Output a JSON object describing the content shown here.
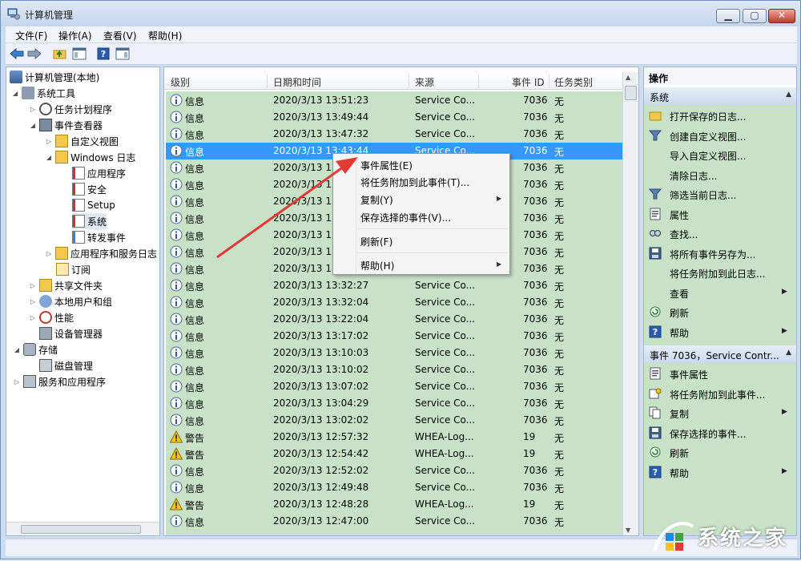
{
  "window": {
    "title": "计算机管理"
  },
  "menu": [
    "文件(F)",
    "操作(A)",
    "查看(V)",
    "帮助(H)"
  ],
  "tree": [
    {
      "label": "计算机管理(本地)"
    },
    {
      "label": "系统工具"
    },
    {
      "label": "任务计划程序"
    },
    {
      "label": "事件查看器"
    },
    {
      "label": "自定义视图"
    },
    {
      "label": "Windows 日志"
    },
    {
      "label": "应用程序"
    },
    {
      "label": "安全"
    },
    {
      "label": "Setup"
    },
    {
      "label": "系统"
    },
    {
      "label": "转发事件"
    },
    {
      "label": "应用程序和服务日志"
    },
    {
      "label": "订阅"
    },
    {
      "label": "共享文件夹"
    },
    {
      "label": "本地用户和组"
    },
    {
      "label": "性能"
    },
    {
      "label": "设备管理器"
    },
    {
      "label": "存储"
    },
    {
      "label": "磁盘管理"
    },
    {
      "label": "服务和应用程序"
    }
  ],
  "columns": {
    "level": "级别",
    "datetime": "日期和时间",
    "source": "来源",
    "event_id": "事件 ID",
    "task": "任务类别"
  },
  "rows": [
    {
      "level": "信息",
      "type": "info",
      "datetime": "2020/3/13 13:51:23",
      "source": "Service Co...",
      "id": "7036",
      "task": "无"
    },
    {
      "level": "信息",
      "type": "info",
      "datetime": "2020/3/13 13:49:44",
      "source": "Service Co...",
      "id": "7036",
      "task": "无"
    },
    {
      "level": "信息",
      "type": "info",
      "datetime": "2020/3/13 13:47:32",
      "source": "Service Co...",
      "id": "7036",
      "task": "无"
    },
    {
      "level": "信息",
      "type": "info",
      "datetime": "2020/3/13 13:43:44",
      "source": "Service Co...",
      "id": "7036",
      "task": "无",
      "selected": true
    },
    {
      "level": "信息",
      "type": "info",
      "datetime": "2020/3/13 13",
      "source": "",
      "id": "7036",
      "task": "无"
    },
    {
      "level": "信息",
      "type": "info",
      "datetime": "2020/3/13 13",
      "source": "",
      "id": "7036",
      "task": "无"
    },
    {
      "level": "信息",
      "type": "info",
      "datetime": "2020/3/13 13",
      "source": "",
      "id": "7036",
      "task": "无"
    },
    {
      "level": "信息",
      "type": "info",
      "datetime": "2020/3/13 13",
      "source": "",
      "id": "7036",
      "task": "无"
    },
    {
      "level": "信息",
      "type": "info",
      "datetime": "2020/3/13 13",
      "source": "",
      "id": "7036",
      "task": "无"
    },
    {
      "level": "信息",
      "type": "info",
      "datetime": "2020/3/13 13",
      "source": "",
      "id": "7036",
      "task": "无"
    },
    {
      "level": "信息",
      "type": "info",
      "datetime": "2020/3/13 13",
      "source": "",
      "id": "7036",
      "task": "无"
    },
    {
      "level": "信息",
      "type": "info",
      "datetime": "2020/3/13 13:32:27",
      "source": "Service Co...",
      "id": "7036",
      "task": "无"
    },
    {
      "level": "信息",
      "type": "info",
      "datetime": "2020/3/13 13:32:04",
      "source": "Service Co...",
      "id": "7036",
      "task": "无"
    },
    {
      "level": "信息",
      "type": "info",
      "datetime": "2020/3/13 13:22:04",
      "source": "Service Co...",
      "id": "7036",
      "task": "无"
    },
    {
      "level": "信息",
      "type": "info",
      "datetime": "2020/3/13 13:17:02",
      "source": "Service Co...",
      "id": "7036",
      "task": "无"
    },
    {
      "level": "信息",
      "type": "info",
      "datetime": "2020/3/13 13:10:03",
      "source": "Service Co...",
      "id": "7036",
      "task": "无"
    },
    {
      "level": "信息",
      "type": "info",
      "datetime": "2020/3/13 13:10:02",
      "source": "Service Co...",
      "id": "7036",
      "task": "无"
    },
    {
      "level": "信息",
      "type": "info",
      "datetime": "2020/3/13 13:07:02",
      "source": "Service Co...",
      "id": "7036",
      "task": "无"
    },
    {
      "level": "信息",
      "type": "info",
      "datetime": "2020/3/13 13:04:29",
      "source": "Service Co...",
      "id": "7036",
      "task": "无"
    },
    {
      "level": "信息",
      "type": "info",
      "datetime": "2020/3/13 13:02:02",
      "source": "Service Co...",
      "id": "7036",
      "task": "无"
    },
    {
      "level": "警告",
      "type": "warning",
      "datetime": "2020/3/13 12:57:32",
      "source": "WHEA-Log...",
      "id": "19",
      "task": "无"
    },
    {
      "level": "警告",
      "type": "warning",
      "datetime": "2020/3/13 12:54:42",
      "source": "WHEA-Log...",
      "id": "19",
      "task": "无"
    },
    {
      "level": "信息",
      "type": "info",
      "datetime": "2020/3/13 12:52:02",
      "source": "Service Co...",
      "id": "7036",
      "task": "无"
    },
    {
      "level": "信息",
      "type": "info",
      "datetime": "2020/3/13 12:49:48",
      "source": "Service Co...",
      "id": "7036",
      "task": "无"
    },
    {
      "level": "警告",
      "type": "warning",
      "datetime": "2020/3/13 12:48:28",
      "source": "WHEA-Log...",
      "id": "19",
      "task": "无"
    },
    {
      "level": "信息",
      "type": "info",
      "datetime": "2020/3/13 12:47:00",
      "source": "Service Co...",
      "id": "7036",
      "task": "无"
    }
  ],
  "context_menu": [
    {
      "label": "事件属性(E)",
      "submenu": false
    },
    {
      "label": "将任务附加到此事件(T)...",
      "submenu": false
    },
    {
      "label": "复制(Y)",
      "submenu": true
    },
    {
      "label": "保存选择的事件(V)...",
      "submenu": false
    },
    {
      "label": "刷新(F)",
      "submenu": false
    },
    {
      "label": "帮助(H)",
      "submenu": true
    }
  ],
  "actions": {
    "title": "操作",
    "section1": {
      "title": "系统"
    },
    "items1": [
      {
        "label": "打开保存的日志...",
        "icon": "folder-open-icon",
        "submenu": false
      },
      {
        "label": "创建自定义视图...",
        "icon": "filter-icon",
        "submenu": false
      },
      {
        "label": "导入自定义视图...",
        "icon": "",
        "submenu": false
      },
      {
        "label": "清除日志...",
        "icon": "",
        "submenu": false
      },
      {
        "label": "筛选当前日志...",
        "icon": "filter-icon",
        "submenu": false
      },
      {
        "label": "属性",
        "icon": "properties-icon",
        "submenu": false
      },
      {
        "label": "查找...",
        "icon": "find-icon",
        "submenu": false
      },
      {
        "label": "将所有事件另存为...",
        "icon": "save-icon",
        "submenu": false
      },
      {
        "label": "将任务附加到此日志...",
        "icon": "",
        "submenu": false
      },
      {
        "label": "查看",
        "icon": "",
        "submenu": true
      },
      {
        "label": "刷新",
        "icon": "refresh-icon",
        "submenu": false
      },
      {
        "label": "帮助",
        "icon": "help-icon",
        "submenu": true
      }
    ],
    "section2": {
      "title": "事件 7036，Service Contr..."
    },
    "items2": [
      {
        "label": "事件属性",
        "icon": "properties-icon",
        "submenu": false
      },
      {
        "label": "将任务附加到此事件...",
        "icon": "task-icon",
        "submenu": false
      },
      {
        "label": "复制",
        "icon": "copy-icon",
        "submenu": true
      },
      {
        "label": "保存选择的事件...",
        "icon": "save-icon",
        "submenu": false
      },
      {
        "label": "刷新",
        "icon": "refresh-icon",
        "submenu": false
      },
      {
        "label": "帮助",
        "icon": "help-icon",
        "submenu": true
      }
    ]
  },
  "watermark": {
    "text": "系统之家"
  },
  "colors": {
    "selection": "#3399ff",
    "row_bg": "#c8e2c8",
    "arrow": "#e53935"
  }
}
